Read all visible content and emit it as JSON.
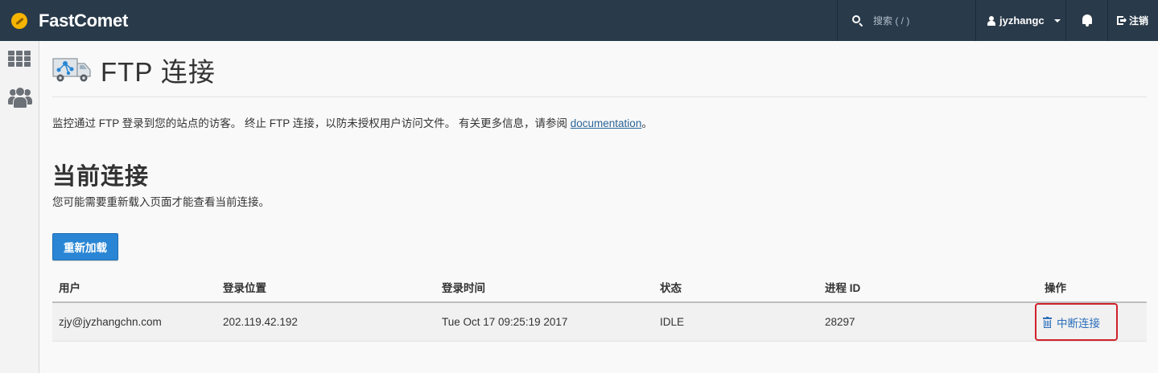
{
  "topbar": {
    "brand": "FastComet",
    "search_placeholder": "搜索 ( / )",
    "username": "jyzhangc",
    "logout": "注销"
  },
  "page": {
    "title": "FTP 连接",
    "intro_text": "监控通过 FTP 登录到您的站点的访客。 终止 FTP 连接，以防未授权用户访问文件。 有关更多信息，请参阅 ",
    "intro_link": "documentation",
    "intro_end": "。",
    "section_title": "当前连接",
    "section_sub": "您可能需要重新载入页面才能查看当前连接。",
    "reload_button": "重新加载"
  },
  "table": {
    "headers": [
      "用户",
      "登录位置",
      "登录时间",
      "状态",
      "进程 ID",
      "操作"
    ],
    "rows": [
      {
        "user": "zjy@jyzhangchn.com",
        "location": "202.119.42.192",
        "login_time": "Tue Oct 17 09:25:19 2017",
        "status": "IDLE",
        "pid": "28297",
        "action": "中断连接"
      }
    ]
  },
  "colors": {
    "topbar": "#293a4a",
    "accent": "#2a86d4",
    "link": "#2a6ebb",
    "highlight": "#d0202a"
  }
}
